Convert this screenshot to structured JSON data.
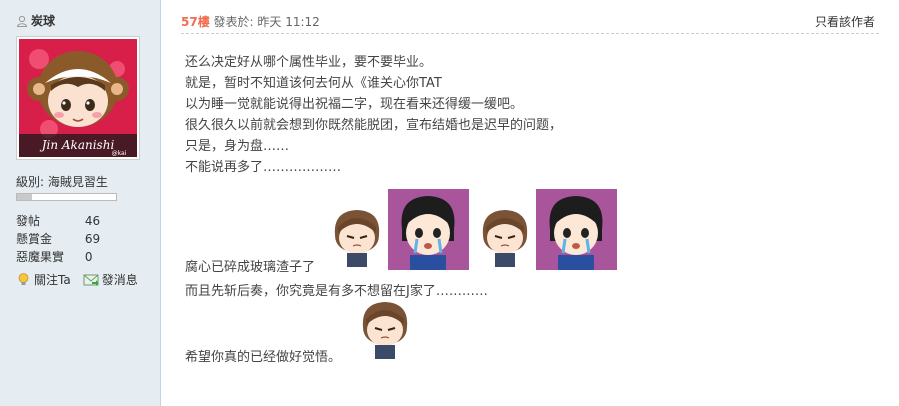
{
  "sidebar": {
    "username": "炭球",
    "avatar_text": "Jin Akanishi",
    "avatar_sub": "@kai",
    "level": "級別: 海賊見習生",
    "level_progress": 0.15,
    "stats": [
      {
        "label": "發帖",
        "value": "46"
      },
      {
        "label": "懸賞金",
        "value": "69"
      },
      {
        "label": "惡魔果實",
        "value": "0"
      }
    ],
    "follow_label": "關注Ta",
    "message_label": "發消息"
  },
  "post": {
    "floor": "57樓",
    "posted": "發表於: 昨天 11:12",
    "only_author": "只看該作者",
    "lines": [
      "还么决定好从哪个属性毕业，要不要毕业。",
      "就是，暂时不知道该何去何从《谁关心你TAT",
      "以为睡一觉就能说得出祝福二字，现在看来还得缓一缓吧。",
      "很久很久以前就会想到你既然能脱团，宣布结婚也是迟早的问题，",
      "只是，身为盘……",
      "不能说再多了………………"
    ],
    "line_emotes": "腐心已碎成玻璃渣子了",
    "line_after": "而且先斩后奏，你究竟是有多不想留在J家了…………",
    "line_last": "希望你真的已经做好觉悟。"
  },
  "colors": {
    "sidebar_bg": "#e5edf2",
    "floor": "#f26c4f",
    "emote_bg": "#a8559b"
  }
}
